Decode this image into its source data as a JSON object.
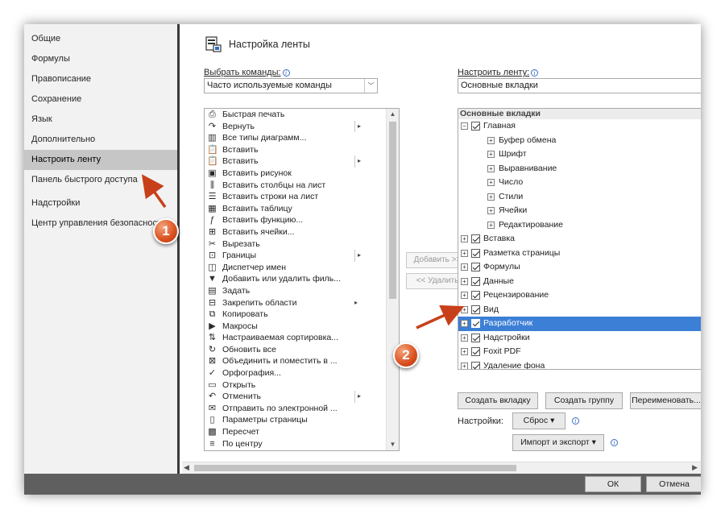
{
  "nav": {
    "items": [
      {
        "label": "Общие"
      },
      {
        "label": "Формулы"
      },
      {
        "label": "Правописание"
      },
      {
        "label": "Сохранение"
      },
      {
        "label": "Язык"
      },
      {
        "label": "Дополнительно"
      },
      {
        "label": "Настроить ленту",
        "selected": true
      },
      {
        "label": "Панель быстрого доступа"
      },
      {
        "label": "Надстройки"
      },
      {
        "label": "Центр управления безопасностью"
      }
    ]
  },
  "header": {
    "title": "Настройка ленты",
    "icon": "ribbon-customize-icon"
  },
  "commands": {
    "label": "Выбрать команды:",
    "selected": "Часто используемые команды",
    "items": [
      {
        "label": "Быстрая печать",
        "icon": "print-icon"
      },
      {
        "label": "Вернуть",
        "icon": "redo-icon",
        "submenu": "bar"
      },
      {
        "label": "Все типы диаграмм...",
        "icon": "chart-icon"
      },
      {
        "label": "Вставить",
        "icon": "paste-icon"
      },
      {
        "label": "Вставить",
        "icon": "paste-icon",
        "submenu": "bar"
      },
      {
        "label": "Вставить рисунок",
        "icon": "picture-icon"
      },
      {
        "label": "Вставить столбцы на лист",
        "icon": "insert-columns-icon"
      },
      {
        "label": "Вставить строки на лист",
        "icon": "insert-rows-icon"
      },
      {
        "label": "Вставить таблицу",
        "icon": "table-icon"
      },
      {
        "label": "Вставить функцию...",
        "icon": "function-icon"
      },
      {
        "label": "Вставить ячейки...",
        "icon": "insert-cells-icon"
      },
      {
        "label": "Вырезать",
        "icon": "cut-icon"
      },
      {
        "label": "Границы",
        "icon": "borders-icon",
        "submenu": "bar"
      },
      {
        "label": "Диспетчер имен",
        "icon": "name-manager-icon"
      },
      {
        "label": "Добавить или удалить филь...",
        "icon": "filter-icon"
      },
      {
        "label": "Задать",
        "icon": "set-icon"
      },
      {
        "label": "Закрепить области",
        "icon": "freeze-panes-icon",
        "submenu": "plain"
      },
      {
        "label": "Копировать",
        "icon": "copy-icon"
      },
      {
        "label": "Макросы",
        "icon": "macros-icon"
      },
      {
        "label": "Настраиваемая сортировка...",
        "icon": "sort-icon"
      },
      {
        "label": "Обновить все",
        "icon": "refresh-icon"
      },
      {
        "label": "Объединить и поместить в ...",
        "icon": "merge-icon"
      },
      {
        "label": "Орфография...",
        "icon": "spelling-icon"
      },
      {
        "label": "Открыть",
        "icon": "open-folder-icon"
      },
      {
        "label": "Отменить",
        "icon": "undo-icon",
        "submenu": "bar"
      },
      {
        "label": "Отправить по электронной ...",
        "icon": "email-icon"
      },
      {
        "label": "Параметры страницы",
        "icon": "page-setup-icon"
      },
      {
        "label": "Пересчет",
        "icon": "calculator-icon"
      },
      {
        "label": "По центру",
        "icon": "align-center-icon"
      }
    ]
  },
  "mid_buttons": {
    "add": "Добавить >>",
    "remove": "<< Удалить"
  },
  "ribbon": {
    "label": "Настроить ленту:",
    "selected": "Основные вкладки",
    "tree_header": "Основные вкладки",
    "items": [
      {
        "label": "Главная",
        "level": 0,
        "expander": "⊟",
        "checkbox": true
      },
      {
        "label": "Буфер обмена",
        "level": 1,
        "expander": "⊞",
        "checkbox": false
      },
      {
        "label": "Шрифт",
        "level": 1,
        "expander": "⊞",
        "checkbox": false
      },
      {
        "label": "Выравнивание",
        "level": 1,
        "expander": "⊞",
        "checkbox": false
      },
      {
        "label": "Число",
        "level": 1,
        "expander": "⊞",
        "checkbox": false
      },
      {
        "label": "Стили",
        "level": 1,
        "expander": "⊞",
        "checkbox": false
      },
      {
        "label": "Ячейки",
        "level": 1,
        "expander": "⊞",
        "checkbox": false
      },
      {
        "label": "Редактирование",
        "level": 1,
        "expander": "⊞",
        "checkbox": false
      },
      {
        "label": "Вставка",
        "level": 0,
        "expander": "⊞",
        "checkbox": true
      },
      {
        "label": "Разметка страницы",
        "level": 0,
        "expander": "⊞",
        "checkbox": true
      },
      {
        "label": "Формулы",
        "level": 0,
        "expander": "⊞",
        "checkbox": true
      },
      {
        "label": "Данные",
        "level": 0,
        "expander": "⊞",
        "checkbox": true
      },
      {
        "label": "Рецензирование",
        "level": 0,
        "expander": "⊞",
        "checkbox": true
      },
      {
        "label": "Вид",
        "level": 0,
        "expander": "⊞",
        "checkbox": true
      },
      {
        "label": "Разработчик",
        "level": 0,
        "expander": "⊞",
        "checkbox": true,
        "selected": true
      },
      {
        "label": "Надстройки",
        "level": 0,
        "expander": "⊞",
        "checkbox": true
      },
      {
        "label": "Foxit PDF",
        "level": 0,
        "expander": "⊞",
        "checkbox": true
      },
      {
        "label": "Удаление фона",
        "level": 0,
        "expander": "⊞",
        "checkbox": true
      }
    ],
    "buttons": {
      "new_tab": "Создать вкладку",
      "new_group": "Создать группу",
      "rename": "Переименовать..."
    },
    "settings_label": "Настройки:",
    "reset": "Сброс",
    "import_export": "Импорт и экспорт"
  },
  "footer": {
    "ok": "ОК",
    "cancel": "Отмена"
  },
  "annotations": [
    {
      "number": "1"
    },
    {
      "number": "2"
    }
  ],
  "colors": {
    "selection": "#3c7fd6",
    "annotation": "#d9501e",
    "nav_selected": "#c6c6c6"
  }
}
